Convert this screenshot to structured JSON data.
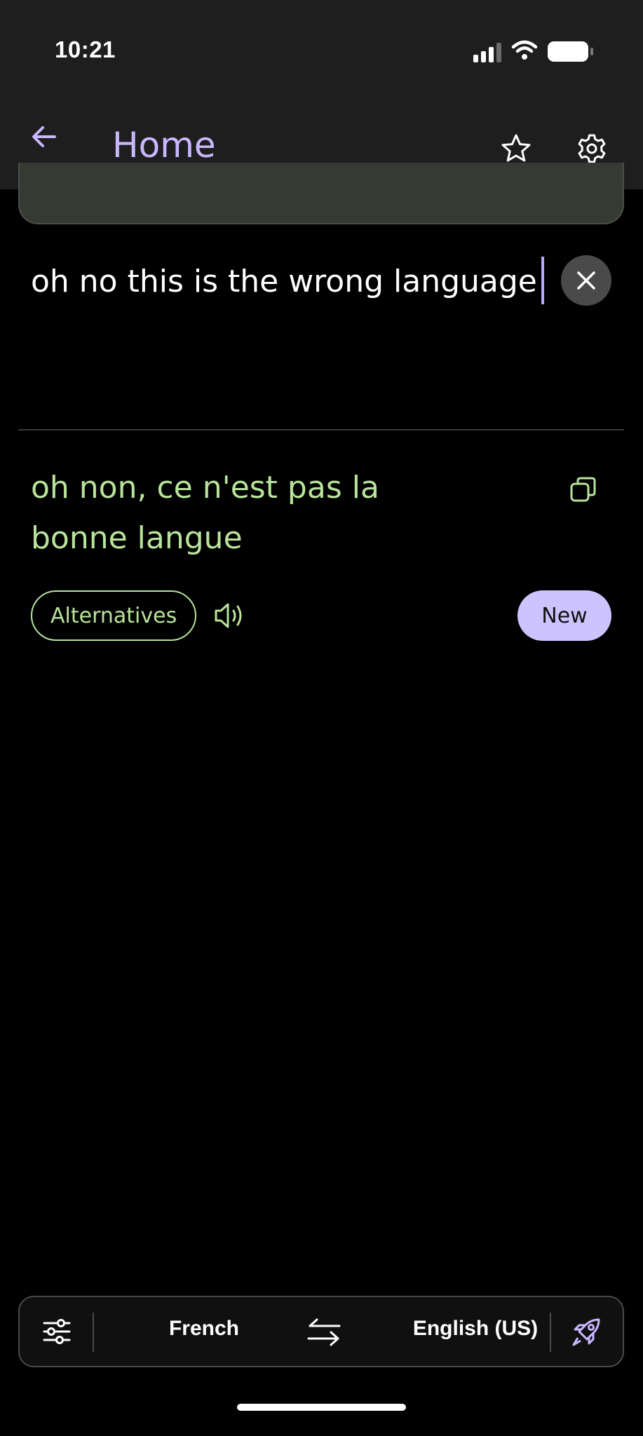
{
  "status_bar": {
    "time": "10:21",
    "icons": [
      "signal-icon",
      "wifi-icon",
      "battery-icon"
    ]
  },
  "header": {
    "title": "Home",
    "icons": [
      "arrow-left-icon",
      "star-icon",
      "gear-icon"
    ]
  },
  "input": {
    "text": "oh no this is the wrong language",
    "clear_icon": "close-icon"
  },
  "translation": {
    "text": "oh non, ce n'est pas la bonne langue",
    "copy_icon": "copy-icon"
  },
  "actions": {
    "alternatives_label": "Alternatives",
    "speaker_icon": "speaker-icon",
    "new_label": "New"
  },
  "language_bar": {
    "source_language": "French",
    "target_language": "English (US)",
    "icons": [
      "sliders-icon",
      "swap-arrows-icon",
      "rocket-icon"
    ]
  },
  "colors": {
    "accent": "#c9b8ff",
    "translation_green": "#b8e39b",
    "new_button_bg": "#cdc4ff",
    "header_bg": "#1e1e1e",
    "background": "#000000"
  }
}
